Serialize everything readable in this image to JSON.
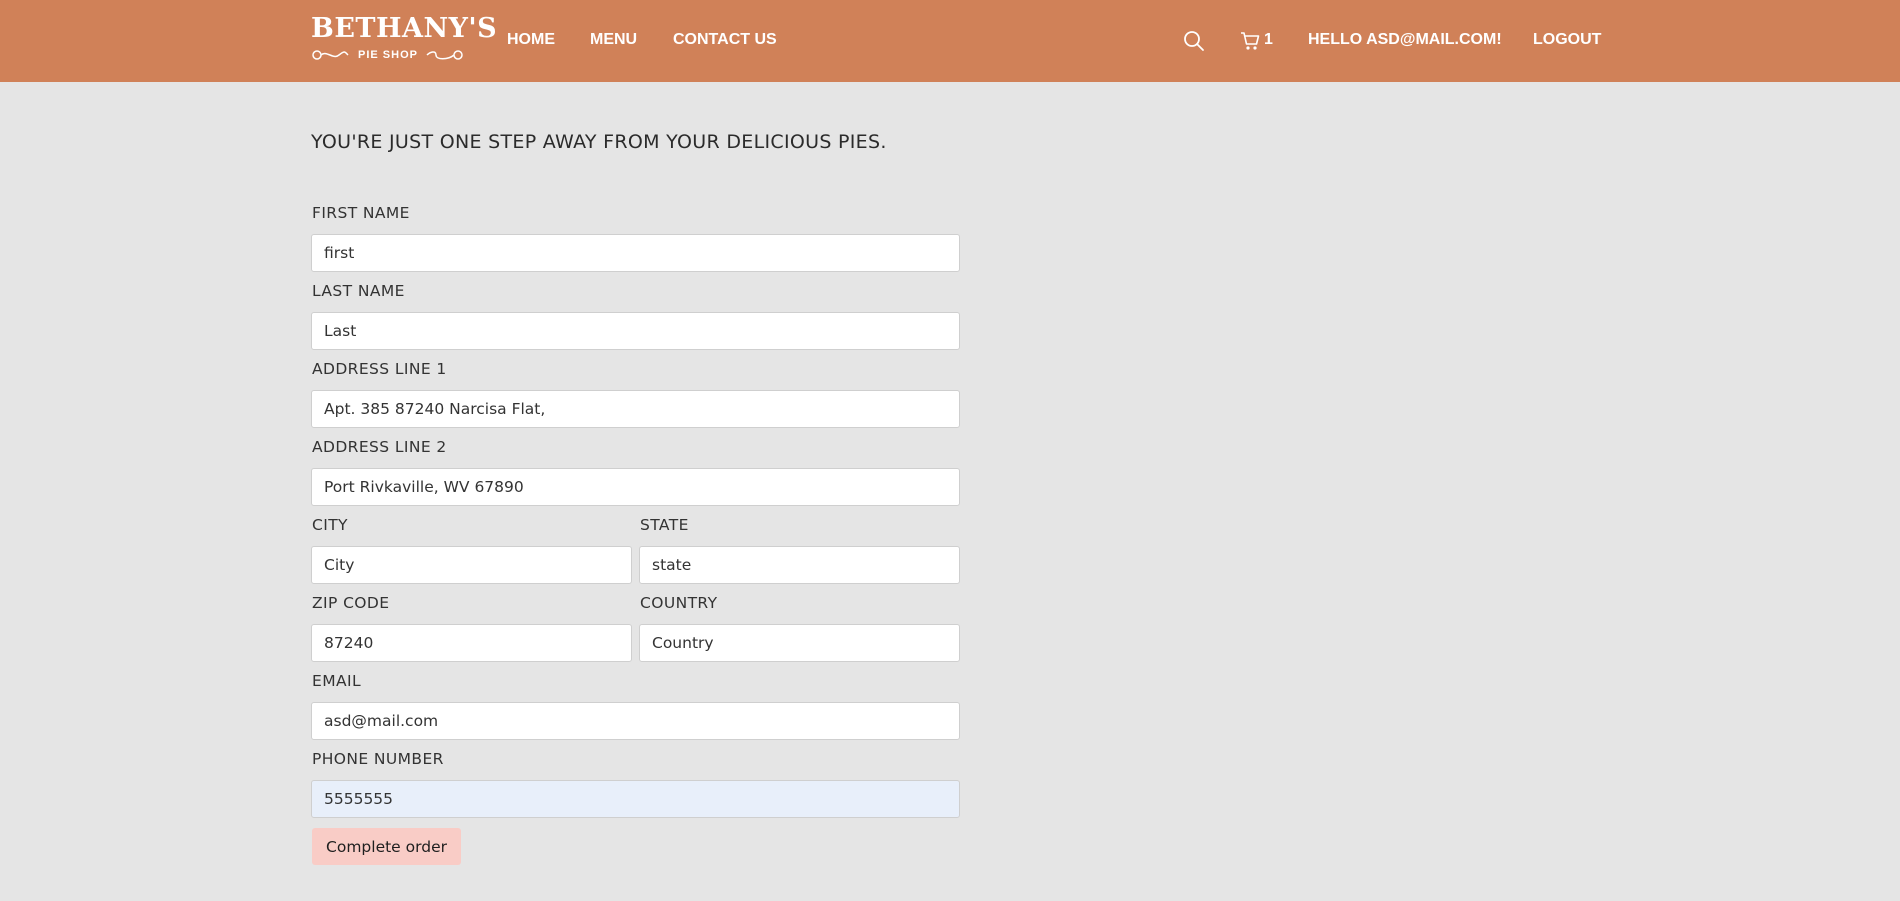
{
  "brand": {
    "logo_main": "BETHANY'S",
    "logo_sub": "PIE SHOP",
    "colors": {
      "header": "#d08158",
      "background": "#e5e5e5",
      "button": "#f9ccc6",
      "autofill": "#e8effa"
    }
  },
  "nav": {
    "home": "HOME",
    "menu": "MENU",
    "contact": "CONTACT US",
    "cart_count": "1",
    "greeting": "HELLO ASD@MAIL.COM!",
    "logout": "LOGOUT",
    "icons": [
      "search-icon",
      "cart-icon"
    ]
  },
  "form": {
    "heading": "YOU'RE JUST ONE STEP AWAY FROM YOUR DELICIOUS PIES.",
    "first_name": {
      "label": "FIRST NAME",
      "value": "first"
    },
    "last_name": {
      "label": "LAST NAME",
      "value": "Last"
    },
    "address1": {
      "label": "ADDRESS LINE 1",
      "value": "Apt. 385 87240 Narcisa Flat,"
    },
    "address2": {
      "label": "ADDRESS LINE 2",
      "value": "Port Rivkaville, WV 67890"
    },
    "city": {
      "label": "CITY",
      "value": "City"
    },
    "state": {
      "label": "STATE",
      "value": "state"
    },
    "zip": {
      "label": "ZIP CODE",
      "value": "87240"
    },
    "country": {
      "label": "COUNTRY",
      "value": "Country"
    },
    "email": {
      "label": "EMAIL",
      "value": "asd@mail.com"
    },
    "phone": {
      "label": "PHONE NUMBER",
      "value": "5555555"
    },
    "submit_label": "Complete order"
  }
}
